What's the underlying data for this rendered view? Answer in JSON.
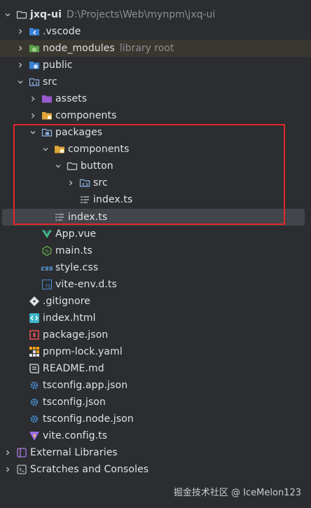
{
  "root": {
    "name": "jxq-ui",
    "path": "D:\\Projects\\Web\\mynpm\\jxq-ui"
  },
  "items": [
    {
      "label": ".vscode"
    },
    {
      "label": "node_modules",
      "hint": "library root"
    },
    {
      "label": "public"
    },
    {
      "label": "src"
    },
    {
      "label": "assets"
    },
    {
      "label": "components"
    },
    {
      "label": "packages"
    },
    {
      "label": "components"
    },
    {
      "label": "button"
    },
    {
      "label": "src"
    },
    {
      "label": "index.ts"
    },
    {
      "label": "index.ts"
    },
    {
      "label": "App.vue"
    },
    {
      "label": "main.ts"
    },
    {
      "label": "style.css"
    },
    {
      "label": "vite-env.d.ts"
    },
    {
      "label": ".gitignore"
    },
    {
      "label": "index.html"
    },
    {
      "label": "package.json"
    },
    {
      "label": "pnpm-lock.yaml"
    },
    {
      "label": "README.md"
    },
    {
      "label": "tsconfig.app.json"
    },
    {
      "label": "tsconfig.json"
    },
    {
      "label": "tsconfig.node.json"
    },
    {
      "label": "vite.config.ts"
    },
    {
      "label": "External Libraries"
    },
    {
      "label": "Scratches and Consoles"
    }
  ],
  "icons": {
    "folder": "folder-icon",
    "file_ts": "typescript-file-icon",
    "vue": "vue-file-icon",
    "css": "css-file-icon",
    "json": "json-file-icon"
  },
  "colors": {
    "highlight": "#e0282e",
    "background": "#2b2d30",
    "selected": "#43454a"
  },
  "watermark": "掘金技术社区 @ IceMelon123"
}
